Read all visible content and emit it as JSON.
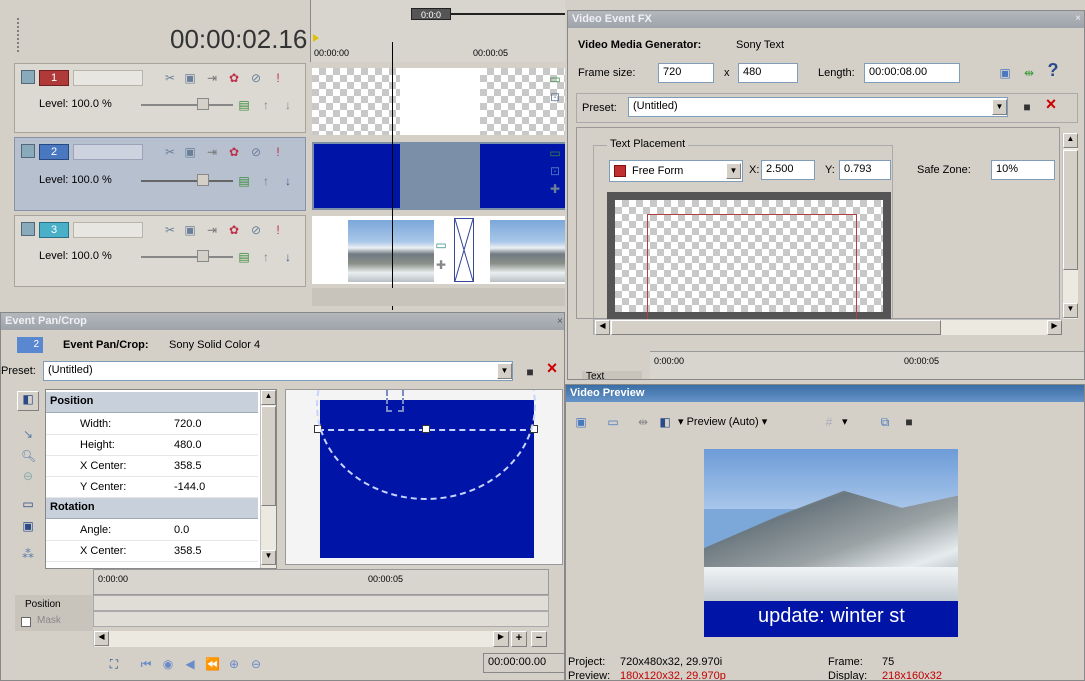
{
  "timeline": {
    "timecode": "00:00:02.16",
    "ruler_marks": [
      "00:00:00",
      "00:00:05"
    ],
    "marker_label": "0:0:0",
    "tracks": [
      {
        "number": "1",
        "level": "Level: 100.0 %",
        "color": "#b03a3a"
      },
      {
        "number": "2",
        "level": "Level: 100.0 %",
        "color": "#4a78c0"
      },
      {
        "number": "3",
        "level": "Level: 100.0 %",
        "color": "#4ab0c8"
      }
    ]
  },
  "fx": {
    "title": "Video Event FX",
    "generator_label": "Video Media Generator:",
    "generator_value": "Sony Text",
    "frame_size_label": "Frame size:",
    "width": "720",
    "x_sep": "x",
    "height": "480",
    "length_label": "Length:",
    "length": "00:00:08.00",
    "preset_label": "Preset:",
    "preset_value": "(Untitled)",
    "group_label": "Text Placement",
    "placement_mode": "Free Form",
    "x_label": "X:",
    "x_value": "2.500",
    "y_label": "Y:",
    "y_value": "0.793",
    "safe_zone_label": "Safe Zone:",
    "safe_zone_value": "10%",
    "ruler_marks": [
      "0:00:00",
      "00:00:05"
    ],
    "tab_label": "Text"
  },
  "pancrop": {
    "title": "Event Pan/Crop",
    "track_badge": "2",
    "header_label": "Event Pan/Crop:",
    "header_value": "Sony Solid Color 4",
    "preset_label": "Preset:",
    "preset_value": "(Untitled)",
    "sections": [
      {
        "name": "Position",
        "rows": [
          {
            "key": "Width:",
            "value": "720.0"
          },
          {
            "key": "Height:",
            "value": "480.0"
          },
          {
            "key": "X Center:",
            "value": "358.5"
          },
          {
            "key": "Y Center:",
            "value": "-144.0"
          }
        ]
      },
      {
        "name": "Rotation",
        "rows": [
          {
            "key": "Angle:",
            "value": "0.0"
          },
          {
            "key": "X Center:",
            "value": "358.5"
          }
        ]
      }
    ],
    "ruler_marks": [
      "0:00:00",
      "00:00:05"
    ],
    "keyframe_track_label": "Position",
    "mask_label": "Mask",
    "timecode": "00:00:00.00"
  },
  "preview": {
    "title": "Video Preview",
    "mode_label": "Preview (Auto)",
    "overlay_text": "update: winter st",
    "project_label": "Project:",
    "project_value": "720x480x32, 29.970i",
    "preview_label": "Preview:",
    "preview_value": "180x120x32, 29.970p",
    "frame_label": "Frame:",
    "frame_value": "75",
    "display_label": "Display:",
    "display_value": "218x160x32"
  },
  "colors": {
    "solid_blue": "#0015a8",
    "title_blue": "#3a6ea5",
    "red_text": "#c00000"
  }
}
